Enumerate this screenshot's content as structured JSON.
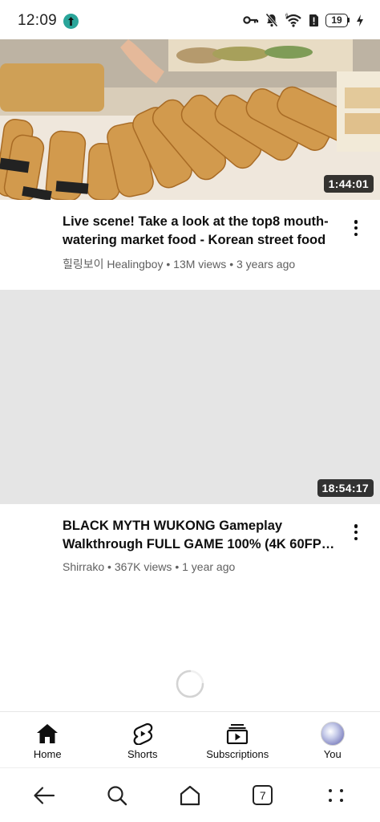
{
  "status_bar": {
    "time": "12:09",
    "battery_level": "19",
    "icons": [
      "key-icon",
      "bell-muted-icon",
      "wifi-icon",
      "sim-alert-icon",
      "battery-icon",
      "charging-icon"
    ]
  },
  "feed": {
    "videos": [
      {
        "title": "Live scene! Take a look at the top8 mouth-watering market food - Korean street food",
        "channel": "힐링보이 Healingboy",
        "views": "13M views",
        "age": "3 years ago",
        "duration": "1:44:01",
        "thumbnail": "korean-street-food-skewers"
      },
      {
        "title": "BLACK MYTH WUKONG Gameplay Walkthrough FULL GAME 100% (4K 60FPS...",
        "title_line1": "BLACK MYTH WUKONG Gameplay",
        "title_line2": "Walkthrough FULL GAME 100% (4K 60FPS...",
        "channel": "Shirrako",
        "views": "367K views",
        "age": "1 year ago",
        "duration": "18:54:17",
        "thumbnail": "loading-placeholder"
      }
    ],
    "separator": "•"
  },
  "bottom_nav": {
    "items": [
      {
        "label": "Home",
        "icon": "home-filled-icon"
      },
      {
        "label": "Shorts",
        "icon": "shorts-icon"
      },
      {
        "label": "Subscriptions",
        "icon": "subscriptions-icon"
      },
      {
        "label": "You",
        "icon": "avatar"
      }
    ]
  },
  "system_nav": {
    "tab_count": "7",
    "buttons": [
      "back-arrow-icon",
      "search-icon",
      "home-icon",
      "tabs-icon",
      "menu-dots-icon"
    ]
  },
  "colors": {
    "text_primary": "#0f0f0f",
    "text_secondary": "#606060",
    "placeholder": "#e5e5e5",
    "duration_bg": "#000000cc"
  }
}
